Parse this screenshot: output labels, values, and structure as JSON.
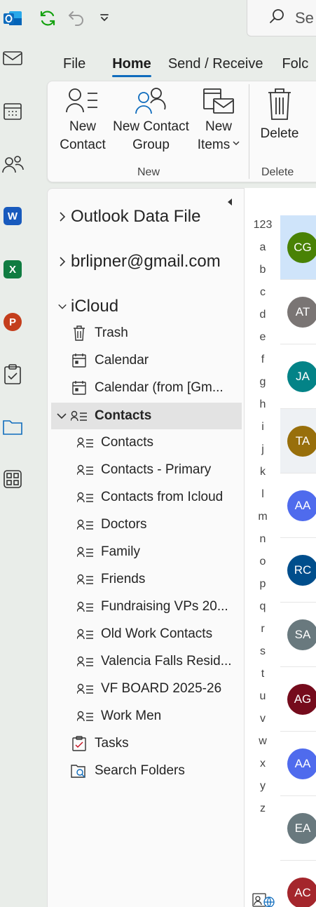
{
  "search": {
    "text": "Se"
  },
  "tabs": [
    {
      "label": "File",
      "active": false
    },
    {
      "label": "Home",
      "active": true
    },
    {
      "label": "Send / Receive",
      "active": false
    },
    {
      "label": "Folc",
      "active": false
    }
  ],
  "ribbon": {
    "new_contact": {
      "line1": "New",
      "line2": "Contact"
    },
    "new_contact_group": {
      "line1": "New Contact",
      "line2": "Group"
    },
    "new_items": {
      "line1": "New",
      "line2": "Items"
    },
    "delete": {
      "label": "Delete"
    },
    "group_new": "New",
    "group_delete": "Delete"
  },
  "folders": {
    "accounts": [
      {
        "label": "Outlook Data File",
        "expanded": false
      },
      {
        "label": "brlipner@gmail.com",
        "expanded": false
      },
      {
        "label": "iCloud",
        "expanded": true
      }
    ],
    "icloud_items": [
      {
        "label": "Trash",
        "icon": "trash-icon"
      },
      {
        "label": "Calendar",
        "icon": "calendar-icon"
      },
      {
        "label": "Calendar (from [Gm...",
        "icon": "calendar-icon"
      }
    ],
    "contacts_parent": {
      "label": "Contacts"
    },
    "contact_folders": [
      "Contacts",
      "Contacts -  Primary",
      "Contacts from Icloud",
      "Doctors",
      "Family",
      "Friends",
      "Fundraising VPs 20...",
      "Old Work Contacts",
      "Valencia Falls Resid...",
      "VF BOARD 2025-26",
      "Work Men"
    ],
    "bottom_items": [
      {
        "label": "Tasks",
        "icon": "tasks-icon"
      },
      {
        "label": "Search Folders",
        "icon": "search-folder-icon"
      }
    ]
  },
  "alphabet": [
    "123",
    "a",
    "b",
    "c",
    "d",
    "e",
    "f",
    "g",
    "h",
    "i",
    "j",
    "k",
    "l",
    "m",
    "n",
    "o",
    "p",
    "q",
    "r",
    "s",
    "t",
    "u",
    "v",
    "w",
    "x",
    "y",
    "z"
  ],
  "contacts": [
    {
      "initials": "CG",
      "color": "#498205",
      "highlight": "blue"
    },
    {
      "initials": "AT",
      "color": "#7a7574",
      "highlight": "none"
    },
    {
      "initials": "JA",
      "color": "#038387",
      "highlight": "none"
    },
    {
      "initials": "TA",
      "color": "#986f0b",
      "highlight": "gray"
    },
    {
      "initials": "AA",
      "color": "#4f6bed",
      "highlight": "none"
    },
    {
      "initials": "RC",
      "color": "#004e8c",
      "highlight": "none"
    },
    {
      "initials": "SA",
      "color": "#69797e",
      "highlight": "none"
    },
    {
      "initials": "AG",
      "color": "#750b1c",
      "highlight": "none"
    },
    {
      "initials": "AA",
      "color": "#4f6bed",
      "highlight": "none"
    },
    {
      "initials": "EA",
      "color": "#69797e",
      "highlight": "none"
    },
    {
      "initials": "AC",
      "color": "#a4262c",
      "highlight": "none"
    }
  ],
  "rail_apps": [
    {
      "letter": "W",
      "color": "#185abd"
    },
    {
      "letter": "X",
      "color": "#107c41"
    },
    {
      "letter": "P",
      "color": "#c43e1c"
    }
  ]
}
